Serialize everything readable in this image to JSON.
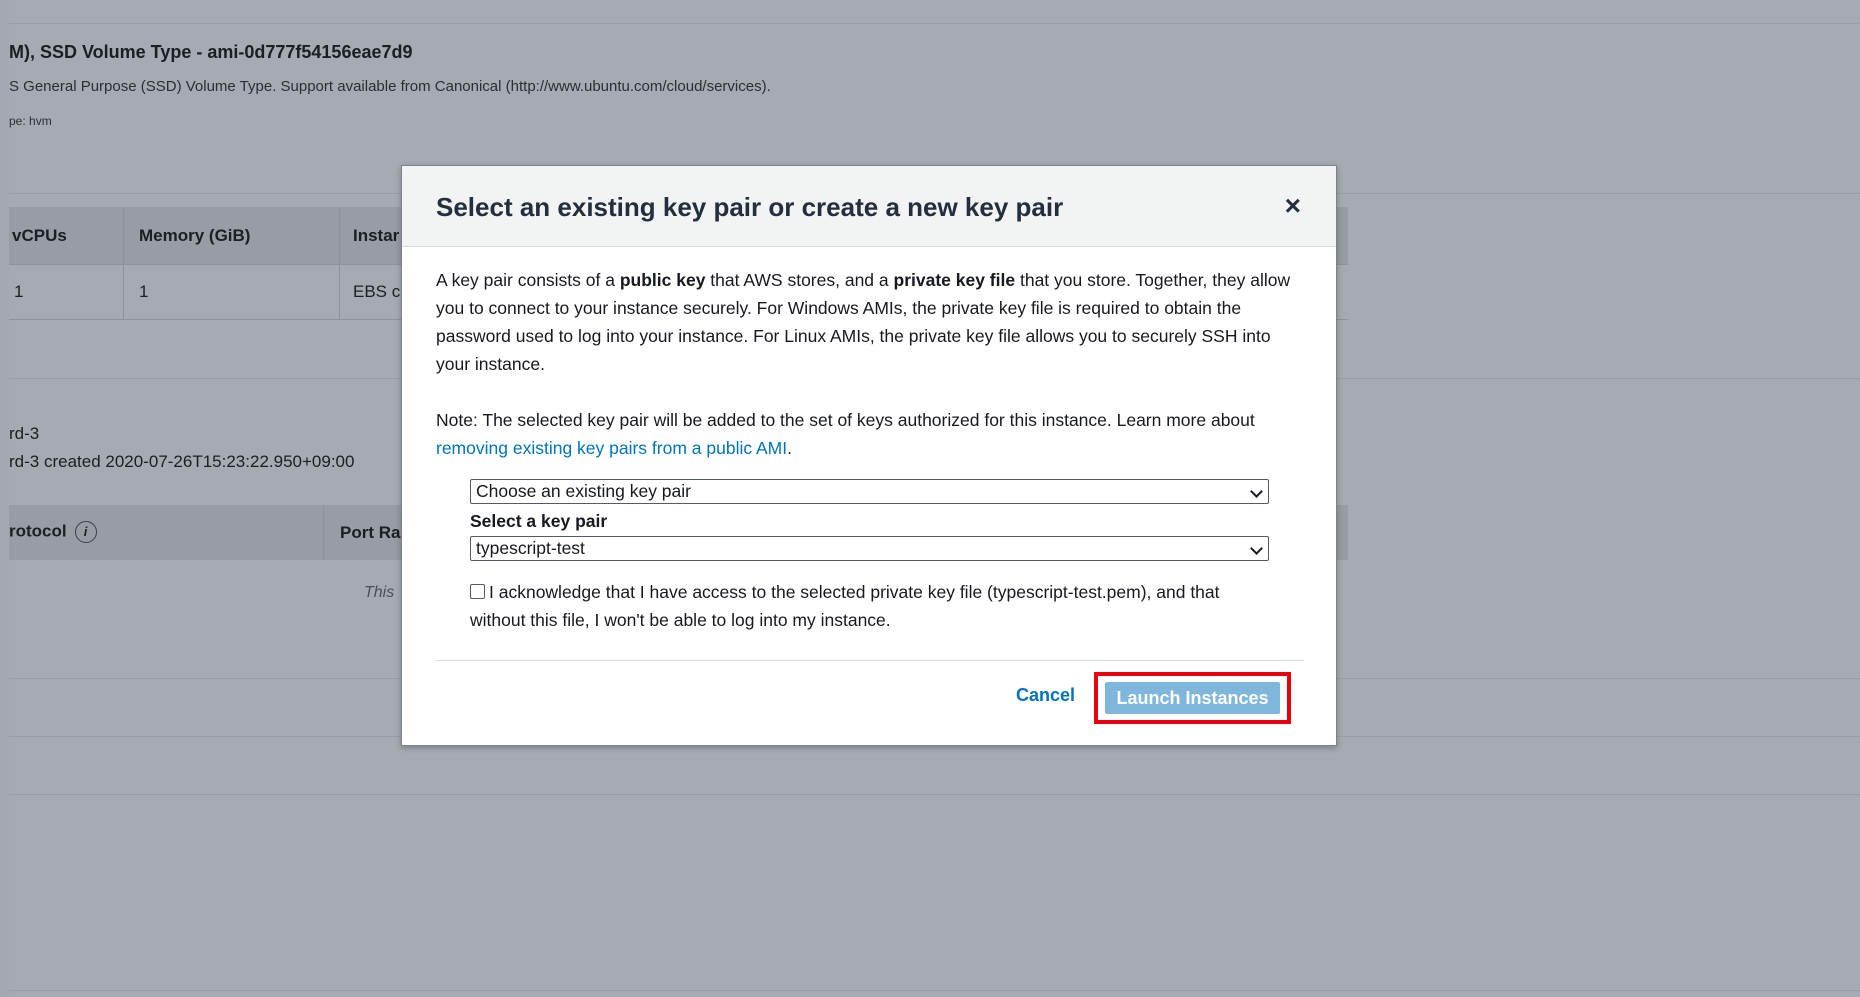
{
  "background": {
    "ami_title": "M), SSD Volume Type - ami-0d777f54156eae7d9",
    "ami_description": "S General Purpose (SSD) Volume Type. Support available from Canonical (http://www.ubuntu.com/cloud/services).",
    "ami_virtualization": "pe: hvm",
    "instance_table": {
      "headers": [
        "vCPUs",
        "Memory (GiB)",
        "Instar"
      ],
      "row": [
        "1",
        "1",
        "EBS c"
      ]
    },
    "security_group": {
      "name": "rd-3",
      "description": "rd-3 created 2020-07-26T15:23:22.950+09:00"
    },
    "rules_table": {
      "headers": [
        "rotocol",
        "Port Ra"
      ],
      "info_icon": "i",
      "empty_text": "This"
    }
  },
  "modal": {
    "title": "Select an existing key pair or create a new key pair",
    "close_glyph": "×",
    "intro": {
      "part1": "A key pair consists of a ",
      "bold1": "public key",
      "part2": " that AWS stores, and a ",
      "bold2": "private key file",
      "part3": " that you store. Together, they allow you to connect to your instance securely. For Windows AMIs, the private key file is required to obtain the password used to log into your instance. For Linux AMIs, the private key file allows you to securely SSH into your instance."
    },
    "note": {
      "text": "Note: The selected key pair will be added to the set of keys authorized for this instance. Learn more about ",
      "link": "removing existing key pairs from a public AMI",
      "end": "."
    },
    "action_select": "Choose an existing key pair",
    "key_pair_label": "Select a key pair",
    "key_pair_select": "typescript-test",
    "acknowledge": "I acknowledge that I have access to the selected private key file (typescript-test.pem), and that without this file, I won't be able to log into my instance.",
    "cancel_label": "Cancel",
    "launch_label": "Launch Instances"
  }
}
